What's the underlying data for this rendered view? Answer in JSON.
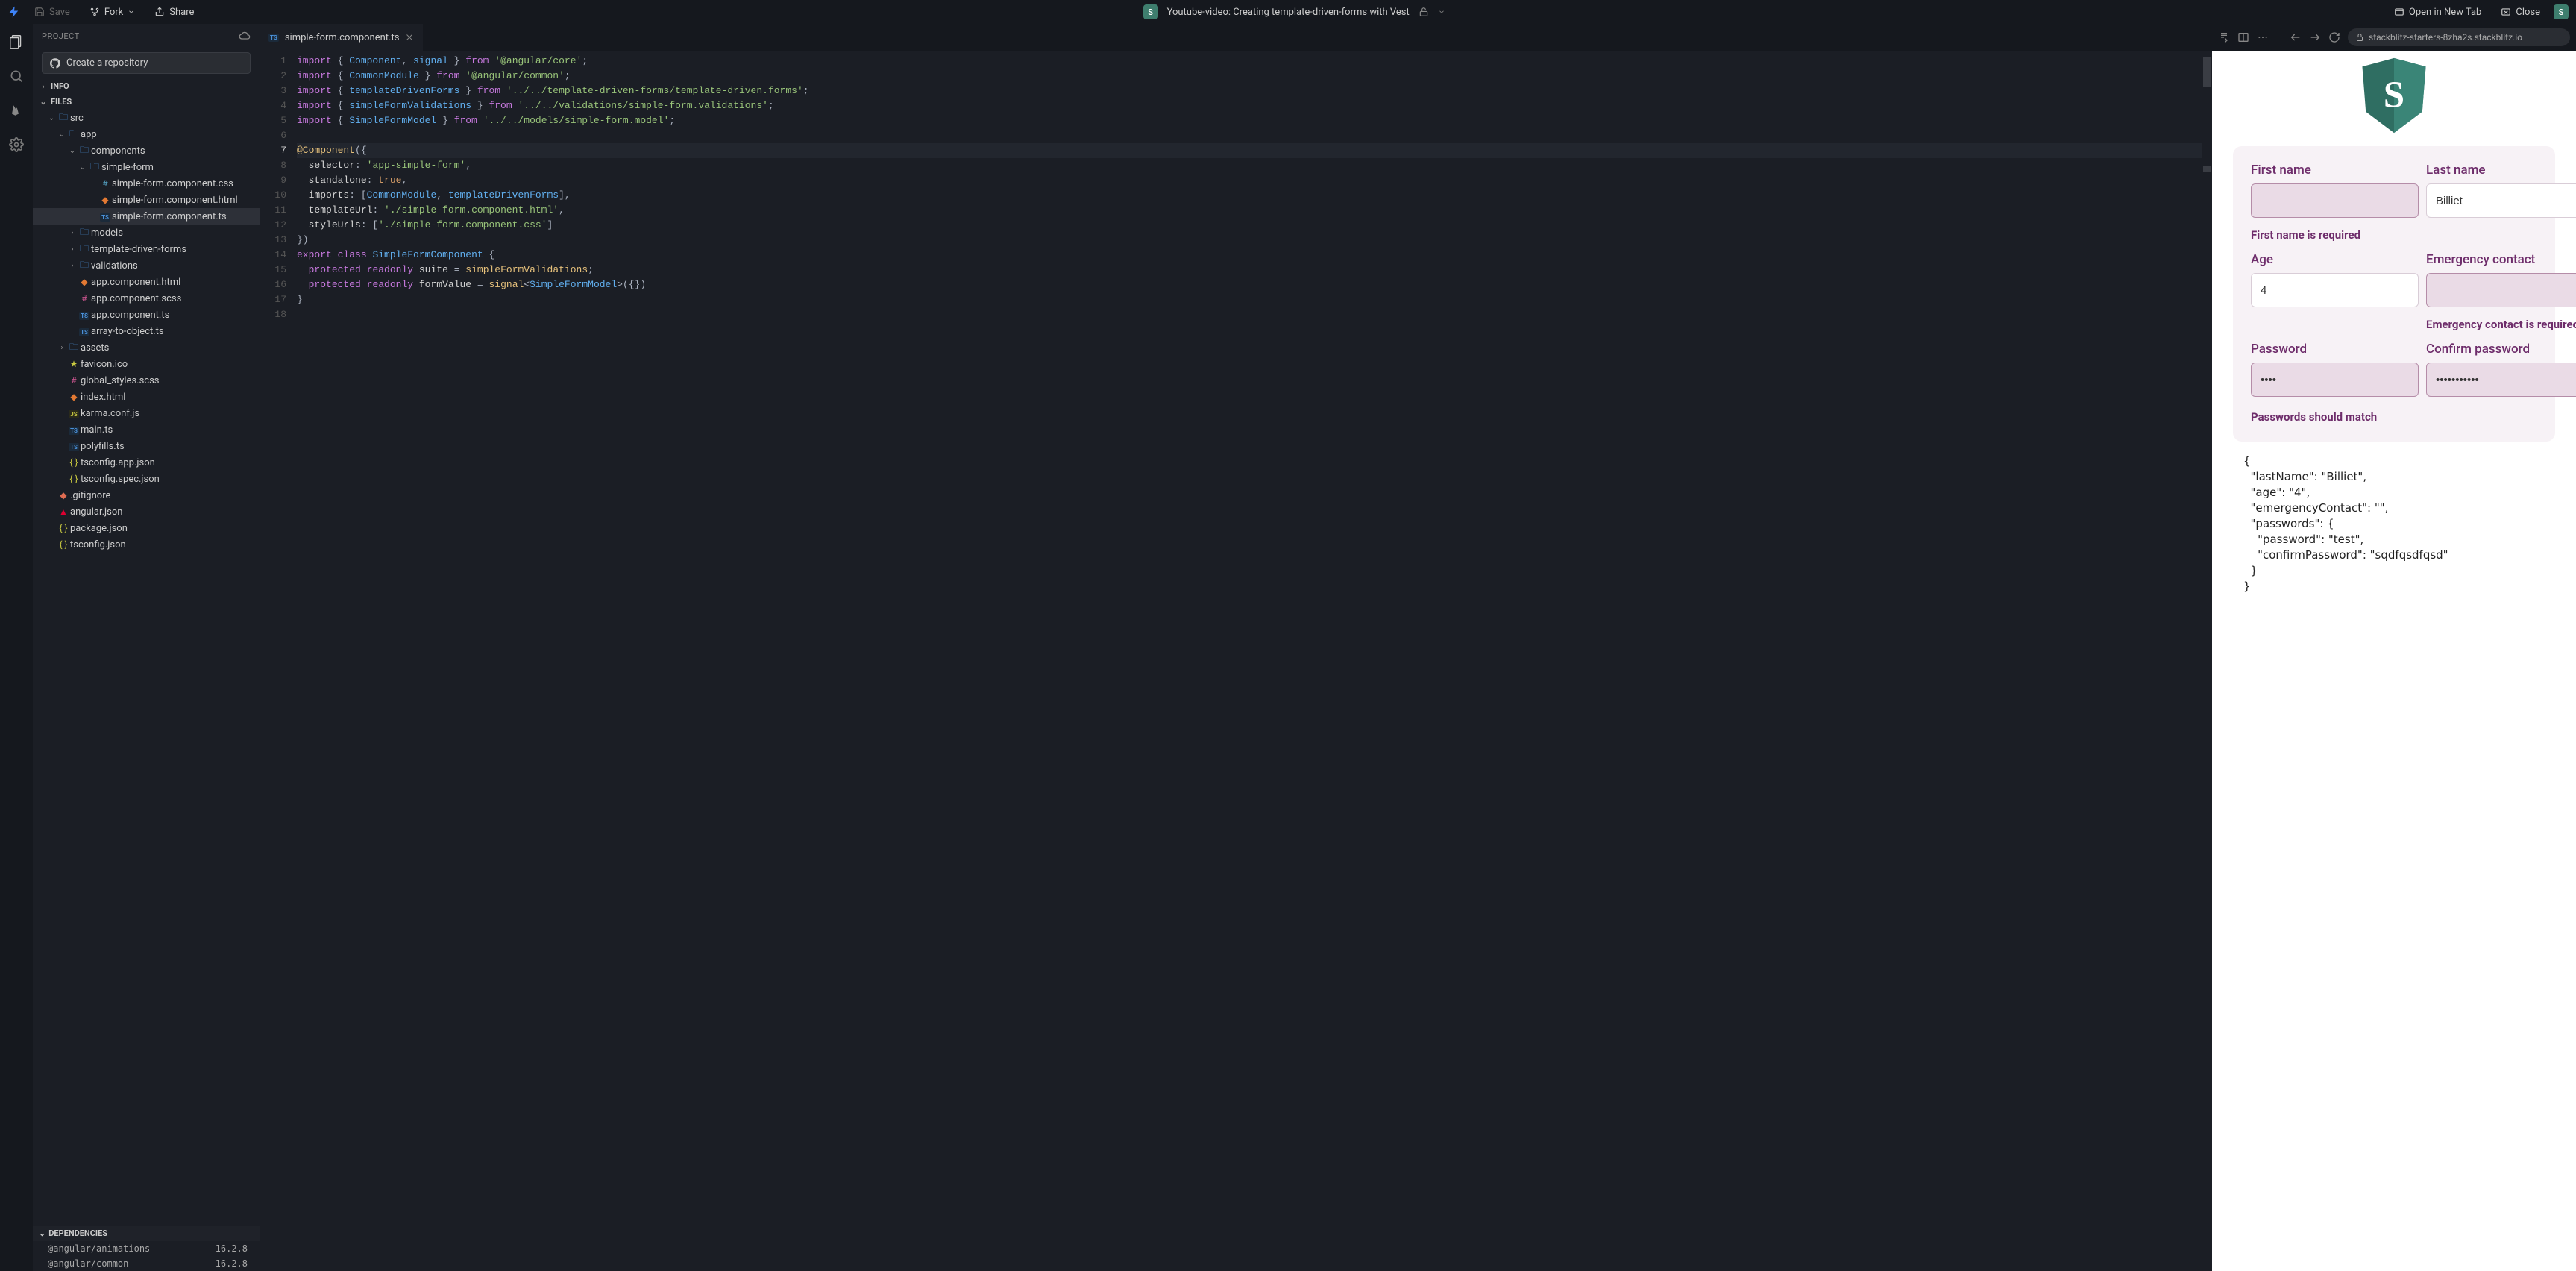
{
  "topbar": {
    "save": "Save",
    "fork": "Fork",
    "share": "Share",
    "open_new_tab": "Open in New Tab",
    "close": "Close",
    "avatar_letter": "S",
    "project_title": "Youtube-video: Creating template-driven-forms with Vest"
  },
  "sidebar": {
    "title": "PROJECT",
    "repo_btn": "Create a repository",
    "info": "INFO",
    "files": "FILES",
    "deps": "DEPENDENCIES",
    "tree": [
      {
        "d": 1,
        "t": "folder",
        "open": true,
        "label": "src"
      },
      {
        "d": 2,
        "t": "folder",
        "open": true,
        "label": "app"
      },
      {
        "d": 3,
        "t": "folder",
        "open": true,
        "label": "components"
      },
      {
        "d": 4,
        "t": "folder",
        "open": true,
        "label": "simple-form"
      },
      {
        "d": 5,
        "t": "css",
        "label": "simple-form.component.css"
      },
      {
        "d": 5,
        "t": "html",
        "label": "simple-form.component.html"
      },
      {
        "d": 5,
        "t": "ts",
        "label": "simple-form.component.ts",
        "selected": true
      },
      {
        "d": 3,
        "t": "folder",
        "open": false,
        "label": "models"
      },
      {
        "d": 3,
        "t": "folder",
        "open": false,
        "label": "template-driven-forms"
      },
      {
        "d": 3,
        "t": "folder",
        "open": false,
        "label": "validations"
      },
      {
        "d": 3,
        "t": "html",
        "label": "app.component.html"
      },
      {
        "d": 3,
        "t": "scss",
        "label": "app.component.scss"
      },
      {
        "d": 3,
        "t": "ts",
        "label": "app.component.ts"
      },
      {
        "d": 3,
        "t": "ts",
        "label": "array-to-object.ts"
      },
      {
        "d": 2,
        "t": "folder",
        "open": false,
        "label": "assets"
      },
      {
        "d": 2,
        "t": "fav",
        "label": "favicon.ico"
      },
      {
        "d": 2,
        "t": "scss",
        "label": "global_styles.scss"
      },
      {
        "d": 2,
        "t": "html",
        "label": "index.html"
      },
      {
        "d": 2,
        "t": "js",
        "label": "karma.conf.js"
      },
      {
        "d": 2,
        "t": "ts",
        "label": "main.ts"
      },
      {
        "d": 2,
        "t": "ts",
        "label": "polyfills.ts"
      },
      {
        "d": 2,
        "t": "json",
        "label": "tsconfig.app.json"
      },
      {
        "d": 2,
        "t": "json",
        "label": "tsconfig.spec.json"
      },
      {
        "d": 1,
        "t": "git",
        "label": ".gitignore"
      },
      {
        "d": 1,
        "t": "ang",
        "label": "angular.json"
      },
      {
        "d": 1,
        "t": "json",
        "label": "package.json"
      },
      {
        "d": 1,
        "t": "json",
        "label": "tsconfig.json"
      }
    ],
    "deps_list": [
      {
        "name": "@angular/animations",
        "ver": "16.2.8"
      },
      {
        "name": "@angular/common",
        "ver": "16.2.8"
      }
    ]
  },
  "editor": {
    "tab": {
      "label": "simple-form.component.ts",
      "icon": "ts"
    },
    "active_line": 7,
    "code": [
      [
        [
          "kw",
          "import"
        ],
        [
          "punc",
          " { "
        ],
        [
          "type",
          "Component"
        ],
        [
          "punc",
          ", "
        ],
        [
          "type",
          "signal"
        ],
        [
          "punc",
          " } "
        ],
        [
          "kw",
          "from"
        ],
        [
          "punc",
          " "
        ],
        [
          "str",
          "'@angular/core'"
        ],
        [
          "punc",
          ";"
        ]
      ],
      [
        [
          "kw",
          "import"
        ],
        [
          "punc",
          " { "
        ],
        [
          "type",
          "CommonModule"
        ],
        [
          "punc",
          " } "
        ],
        [
          "kw",
          "from"
        ],
        [
          "punc",
          " "
        ],
        [
          "str",
          "'@angular/common'"
        ],
        [
          "punc",
          ";"
        ]
      ],
      [
        [
          "kw",
          "import"
        ],
        [
          "punc",
          " { "
        ],
        [
          "type",
          "templateDrivenForms"
        ],
        [
          "punc",
          " } "
        ],
        [
          "kw",
          "from"
        ],
        [
          "punc",
          " "
        ],
        [
          "str",
          "'../../template-driven-forms/template-driven.forms'"
        ],
        [
          "punc",
          ";"
        ]
      ],
      [
        [
          "kw",
          "import"
        ],
        [
          "punc",
          " { "
        ],
        [
          "type",
          "simpleFormValidations"
        ],
        [
          "punc",
          " } "
        ],
        [
          "kw",
          "from"
        ],
        [
          "punc",
          " "
        ],
        [
          "str",
          "'../../validations/simple-form.validations'"
        ],
        [
          "punc",
          ";"
        ]
      ],
      [
        [
          "kw",
          "import"
        ],
        [
          "punc",
          " { "
        ],
        [
          "type",
          "SimpleFormModel"
        ],
        [
          "punc",
          " } "
        ],
        [
          "kw",
          "from"
        ],
        [
          "punc",
          " "
        ],
        [
          "str",
          "'../../models/simple-form.model'"
        ],
        [
          "punc",
          ";"
        ]
      ],
      [],
      [
        [
          "fn",
          "@Component"
        ],
        [
          "punc",
          "("
        ],
        [
          "punc",
          "{"
        ]
      ],
      [
        [
          "punc",
          "  "
        ],
        [
          "prop",
          "selector"
        ],
        [
          "punc",
          ": "
        ],
        [
          "str",
          "'app-simple-form'"
        ],
        [
          "punc",
          ","
        ]
      ],
      [
        [
          "punc",
          "  "
        ],
        [
          "prop",
          "standalone"
        ],
        [
          "punc",
          ": "
        ],
        [
          "bool",
          "true"
        ],
        [
          "punc",
          ","
        ]
      ],
      [
        [
          "punc",
          "  "
        ],
        [
          "prop",
          "imports"
        ],
        [
          "punc",
          ": ["
        ],
        [
          "type",
          "CommonModule"
        ],
        [
          "punc",
          ", "
        ],
        [
          "type",
          "templateDrivenForms"
        ],
        [
          "punc",
          "],"
        ]
      ],
      [
        [
          "punc",
          "  "
        ],
        [
          "prop",
          "templateUrl"
        ],
        [
          "punc",
          ": "
        ],
        [
          "str",
          "'./simple-form.component.html'"
        ],
        [
          "punc",
          ","
        ]
      ],
      [
        [
          "punc",
          "  "
        ],
        [
          "prop",
          "styleUrls"
        ],
        [
          "punc",
          ": ["
        ],
        [
          "str",
          "'./simple-form.component.css'"
        ],
        [
          "punc",
          "]"
        ]
      ],
      [
        [
          "punc",
          "})"
        ]
      ],
      [
        [
          "kw",
          "export"
        ],
        [
          "punc",
          " "
        ],
        [
          "kw",
          "class"
        ],
        [
          "punc",
          " "
        ],
        [
          "type",
          "SimpleFormComponent"
        ],
        [
          "punc",
          " {"
        ]
      ],
      [
        [
          "punc",
          "  "
        ],
        [
          "kw",
          "protected"
        ],
        [
          "punc",
          " "
        ],
        [
          "kw",
          "readonly"
        ],
        [
          "punc",
          " "
        ],
        [
          "prop",
          "suite"
        ],
        [
          "punc",
          " = "
        ],
        [
          "fn",
          "simpleFormValidations"
        ],
        [
          "punc",
          ";"
        ]
      ],
      [
        [
          "punc",
          "  "
        ],
        [
          "kw",
          "protected"
        ],
        [
          "punc",
          " "
        ],
        [
          "kw",
          "readonly"
        ],
        [
          "punc",
          " "
        ],
        [
          "prop",
          "formValue"
        ],
        [
          "punc",
          " = "
        ],
        [
          "fn",
          "signal"
        ],
        [
          "punc",
          "<"
        ],
        [
          "type",
          "SimpleFormModel"
        ],
        [
          "punc",
          ">({})"
        ]
      ],
      [
        [
          "punc",
          "}"
        ]
      ],
      []
    ]
  },
  "preview": {
    "url": "stackblitz-starters-8zha2s.stackblitz.io",
    "shield_letter": "S",
    "fields": {
      "first_name": {
        "label": "First name",
        "value": "",
        "invalid": true
      },
      "last_name": {
        "label": "Last name",
        "value": "Billiet",
        "invalid": false
      },
      "age": {
        "label": "Age",
        "value": "4",
        "invalid": false
      },
      "emergency": {
        "label": "Emergency contact",
        "value": "",
        "invalid": true
      },
      "password": {
        "label": "Password",
        "value": "••••",
        "invalid": true
      },
      "confirm": {
        "label": "Confirm password",
        "value": "•••••••••••",
        "invalid": true
      }
    },
    "errors": {
      "first_name": "First name is required",
      "emergency": "Emergency contact is required",
      "passwords": "Passwords should match"
    },
    "json_lines": [
      "{",
      "  \"lastName\": \"Billiet\",",
      "  \"age\": \"4\",",
      "  \"emergencyContact\": \"\",",
      "  \"passwords\": {",
      "    \"password\": \"test\",",
      "    \"confirmPassword\": \"sqdfqsdfqsd\"",
      "  }",
      "}"
    ]
  }
}
